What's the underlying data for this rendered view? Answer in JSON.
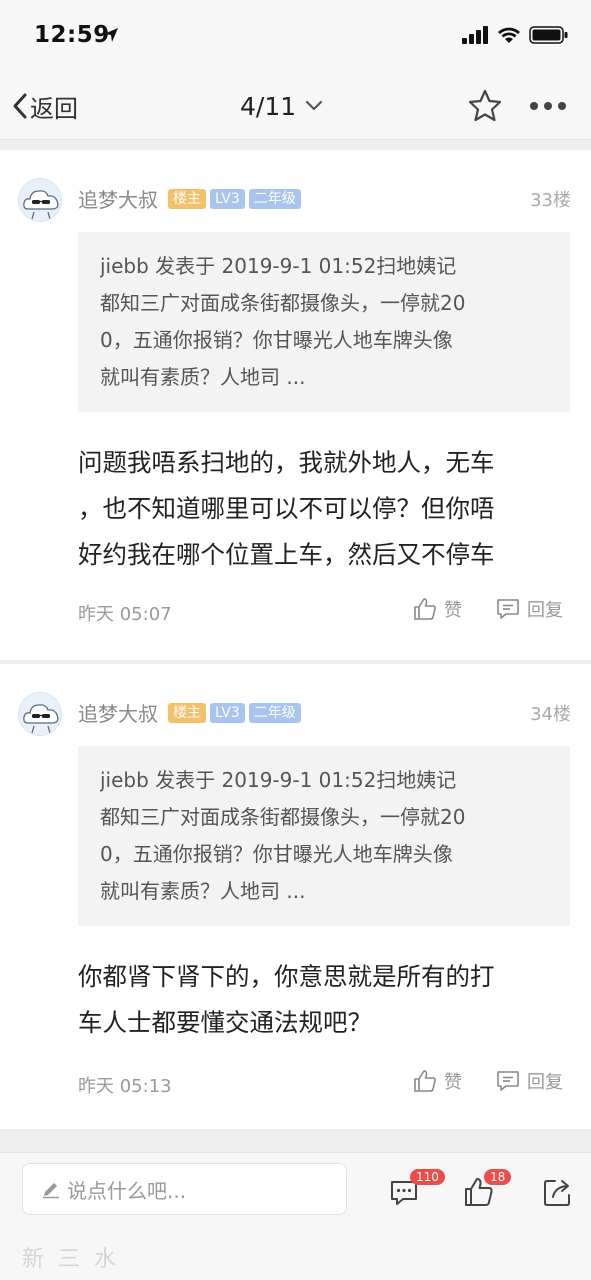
{
  "status_bar": {
    "time": "12:59"
  },
  "nav": {
    "back_label": "返回",
    "page_indicator": "4/11"
  },
  "posts": [
    {
      "username": "追梦大叔",
      "badges": {
        "host": "楼主",
        "level": "LV3",
        "grade": "二年级"
      },
      "floor": "33楼",
      "quote_lines": [
        "jiebb 发表于 2019-9-1 01:52扫地姨记",
        "都知三广对面成条街都摄像头，一停就20",
        "0，五通你报销？你甘曝光人地车牌头像",
        "就叫有素质？人地司 ..."
      ],
      "body_lines": [
        "问题我唔系扫地的，我就外地人，无车",
        "，也不知道哪里可以不可以停？但你唔",
        "好约我在哪个位置上车，然后又不停车"
      ],
      "time": "昨天 05:07",
      "like_label": "赞",
      "reply_label": "回复"
    },
    {
      "username": "追梦大叔",
      "badges": {
        "host": "楼主",
        "level": "LV3",
        "grade": "二年级"
      },
      "floor": "34楼",
      "quote_lines": [
        "jiebb 发表于 2019-9-1 01:52扫地姨记",
        "都知三广对面成条街都摄像头，一停就20",
        "0，五通你报销？你甘曝光人地车牌头像",
        "就叫有素质？人地司 ..."
      ],
      "body_lines": [
        "你都肾下肾下的，你意思就是所有的打",
        "车人士都要懂交通法规吧？"
      ],
      "time": "昨天 05:13",
      "like_label": "赞",
      "reply_label": "回复"
    }
  ],
  "bottom_bar": {
    "comment_placeholder": "说点什么吧...",
    "comments_count": "110",
    "likes_count": "18",
    "watermark": "新三水"
  },
  "colors": {
    "host_badge": "#f4c16b",
    "level_badge": "#a9c4ee",
    "count_badge": "#f04b4b"
  },
  "icons": [
    "location-arrow-icon",
    "signal-icon",
    "wifi-icon",
    "battery-icon",
    "back-chevron-icon",
    "chevron-down-icon",
    "star-icon",
    "more-icon",
    "thumbs-up-icon",
    "reply-icon",
    "pencil-icon",
    "comments-icon",
    "share-icon"
  ]
}
